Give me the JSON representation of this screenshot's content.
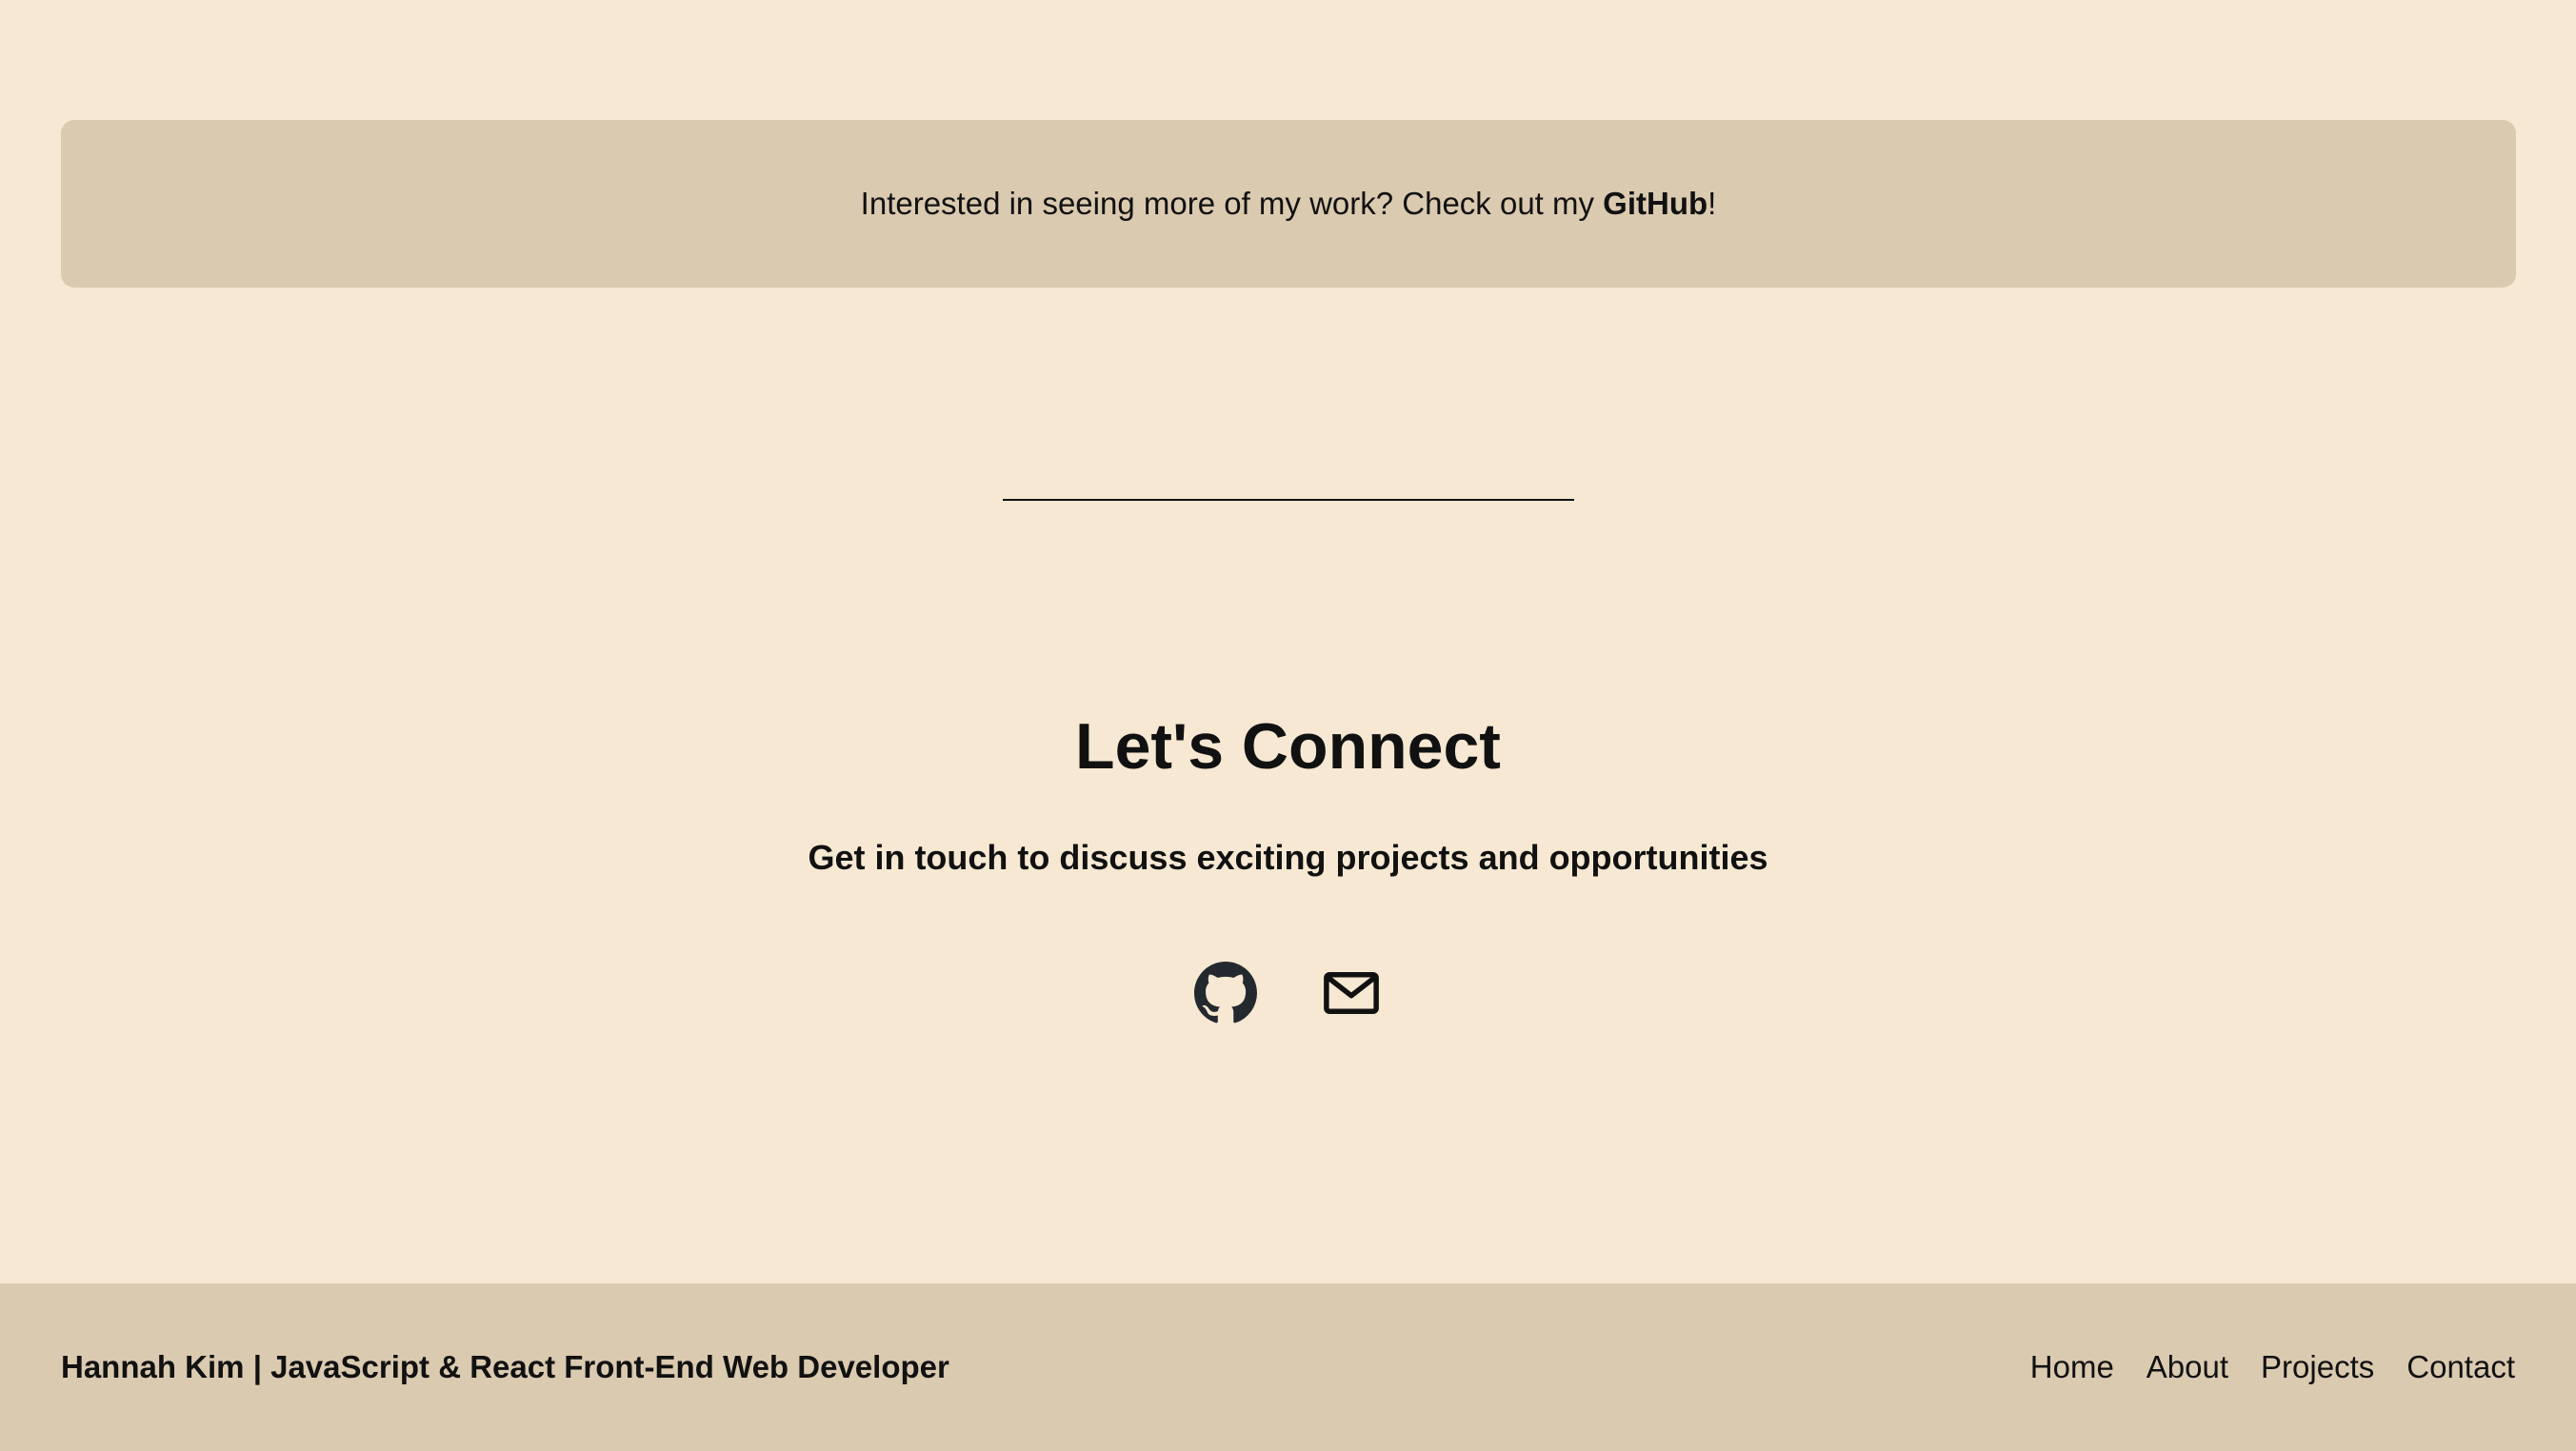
{
  "banner": {
    "text": "Interested in seeing more of my work? Check out my ",
    "link_label": "GitHub",
    "suffix": "!"
  },
  "contact": {
    "title": "Let's Connect",
    "subtitle": "Get in touch to discuss exciting projects and opportunities",
    "links": [
      {
        "icon": "github-icon"
      },
      {
        "icon": "mail-icon"
      }
    ]
  },
  "footer": {
    "credit": "Hannah Kim | JavaScript & React Front-End Web Developer",
    "nav": [
      "Home",
      "About",
      "Projects",
      "Contact"
    ]
  },
  "colors": {
    "background": "#f6e8d2",
    "panel": "#dacab0",
    "text": "#111111",
    "icon": "#24292f"
  }
}
